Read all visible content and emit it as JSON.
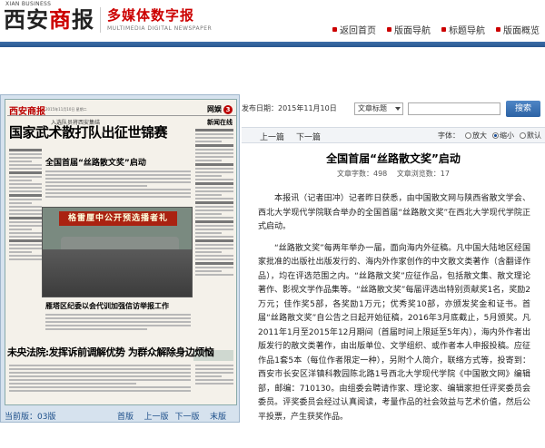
{
  "header": {
    "logo_small": "XIAN BUSINESS",
    "logo_main_pre": "西安",
    "logo_main_accent": "商",
    "logo_main_post": "报",
    "brand_title": "多媒体数字报",
    "brand_sub": "MULTIMEDIA DIGITAL NEWSPAPER",
    "nav": [
      "返回首页",
      "版面导航",
      "标题导航",
      "版面概览"
    ]
  },
  "toolbar": {
    "date": "发布日期：2015年11月10日",
    "select_value": "文章标题",
    "search_label": "搜索"
  },
  "article_nav": {
    "prev": "上一篇",
    "next": "下一篇",
    "font_label": "字体：",
    "font_options": [
      "放大",
      "缩小",
      "默认"
    ]
  },
  "article": {
    "title": "全国首届“丝路散文奖”启动",
    "word_count": "文章字数：498",
    "views": "文章浏览数：17",
    "paragraphs": [
      "本报讯（记者田冲）记者昨日获悉，由中国散文网与陕西省散文学会、西北大学现代学院联合举办的全国首届“丝路散文奖”在西北大学现代学院正式启动。",
      "“丝路散文奖”每两年举办一届，面向海内外征稿。凡中国大陆地区经国家批准的出版社出版发行的、海内外作家创作的中文散文类著作（含翻译作品），均在评选范围之内。“丝路散文奖”应征作品，包括散文集、散文理论著作、影视文学作品集等。“丝路散文奖”每届评选出特别贡献奖1名，奖励2万元；佳作奖5部，各奖励1万元；优秀奖10部，亦颁发奖金和证书。首届“丝路散文奖”自公告之日起开始征稿，2016年3月底截止，5月颁奖。凡2011年1月至2015年12月期间（首届时间上限延至5年内），海内外作者出版发行的散文类著作，由出版单位、文学组织、或作者本人申报投稿。应征作品1套5本（每位作者限定一种），另附个人简介，联络方式等，投寄到：西安市长安区洋镇科教园陈北路1号西北大学现代学院《中国散文网》编辑部，邮编：710130。由组委会聘请作家、理论家、编辑家担任评奖委员会委员。评奖委员会经过认真阅读，考量作品的社会效益与艺术价值，然后公平投票，产生获奖作品。"
    ]
  },
  "newspaper": {
    "mast_name": "西安商报",
    "mast_line": "2015年11月10日 星期二",
    "section": "网娱",
    "section_num": "3",
    "kicker": "入选队员将西安集结",
    "headline1": "国家武术散打队出征世锦赛",
    "side_title": "新闻在线",
    "headline2": "全国首届“丝路散文奖”启动",
    "photo_banner": "格雷厘中公开预选播者礼",
    "headline3": "雁塔区纪委以会代训加强信访举报工作",
    "headline4": "未央法院:发挥诉前调解优势 为群众解除身边烦恼",
    "footer_label": "当前版：03版",
    "footer_links": [
      "首版",
      "上一版",
      "下一版",
      "末版"
    ]
  }
}
